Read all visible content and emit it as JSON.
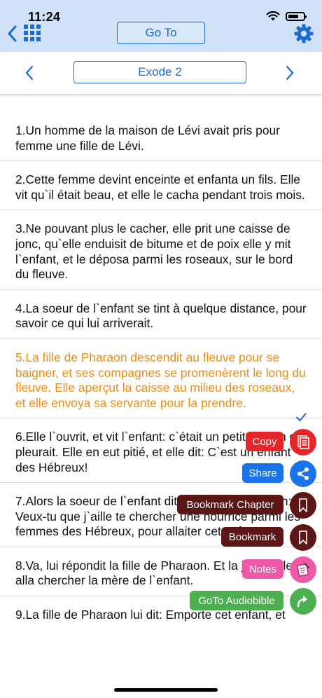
{
  "status": {
    "time": "11:24"
  },
  "header": {
    "goto_label": "Go To"
  },
  "chapter": {
    "title": "Exode 2"
  },
  "verses": [
    "1.Un homme de la maison de Lévi avait pris pour femme une fille de Lévi.",
    "2.Cette femme devint enceinte et enfanta un fils. Elle vit qu`il était beau, et elle le cacha pendant trois mois.",
    "3.Ne pouvant plus le cacher, elle prit une caisse de jonc, qu`elle enduisit de bitume et de poix elle y mit l`enfant, et le déposa parmi les roseaux, sur le bord du fleuve.",
    "4.La soeur de l`enfant se tint à quelque distance, pour savoir ce qui lui arriverait.",
    "5.La fille de Pharaon descendit au fleuve pour se baigner, et ses compagnes se promenèrent le long du fleuve. Elle aperçut la caisse au milieu des roseaux, et elle envoya sa servante pour la prendre.",
    "6.Elle l`ouvrit, et vit l`enfant: c`était un petit garçon qui pleurait. Elle en eut pitié, et elle dit: C`est un enfant des Hébreux!",
    "7.Alors la soeur de l`enfant dit à la fille de Pharaon: Veux-tu que j`aille te chercher une nourrice parmi les femmes des Hébreux, pour allaiter cet enfant?",
    "8.Va, lui répondit la fille de Pharaon. Et la jeune fille alla chercher la mère de l`enfant.",
    "9.La fille de Pharaon lui dit: Emporte cet enfant, et"
  ],
  "actions": {
    "copy": "Copy",
    "share": "Share",
    "bookmark_chapter": "Bookmark Chapter",
    "bookmark": "Bookmark",
    "notes": "Notes",
    "goto_audio": "GoTo Audiobible"
  },
  "colors": {
    "accent": "#1b6ad6",
    "header_bg": "#cfe2f7",
    "selected_verse": "#ef8b12",
    "copy": "#e4262b",
    "share": "#1a73e8",
    "bookmark": "#5c1616",
    "notes": "#ee5aa7",
    "goto_audio": "#4caf50"
  },
  "icons": [
    "back-arrow-icon",
    "grid-icon",
    "settings-gear-icon",
    "chevron-left-icon",
    "chevron-right-icon",
    "checkmark-icon",
    "copy-icon",
    "share-icon",
    "bookmark-chapter-icon",
    "bookmark-icon",
    "notes-icon",
    "goto-arrow-icon"
  ]
}
